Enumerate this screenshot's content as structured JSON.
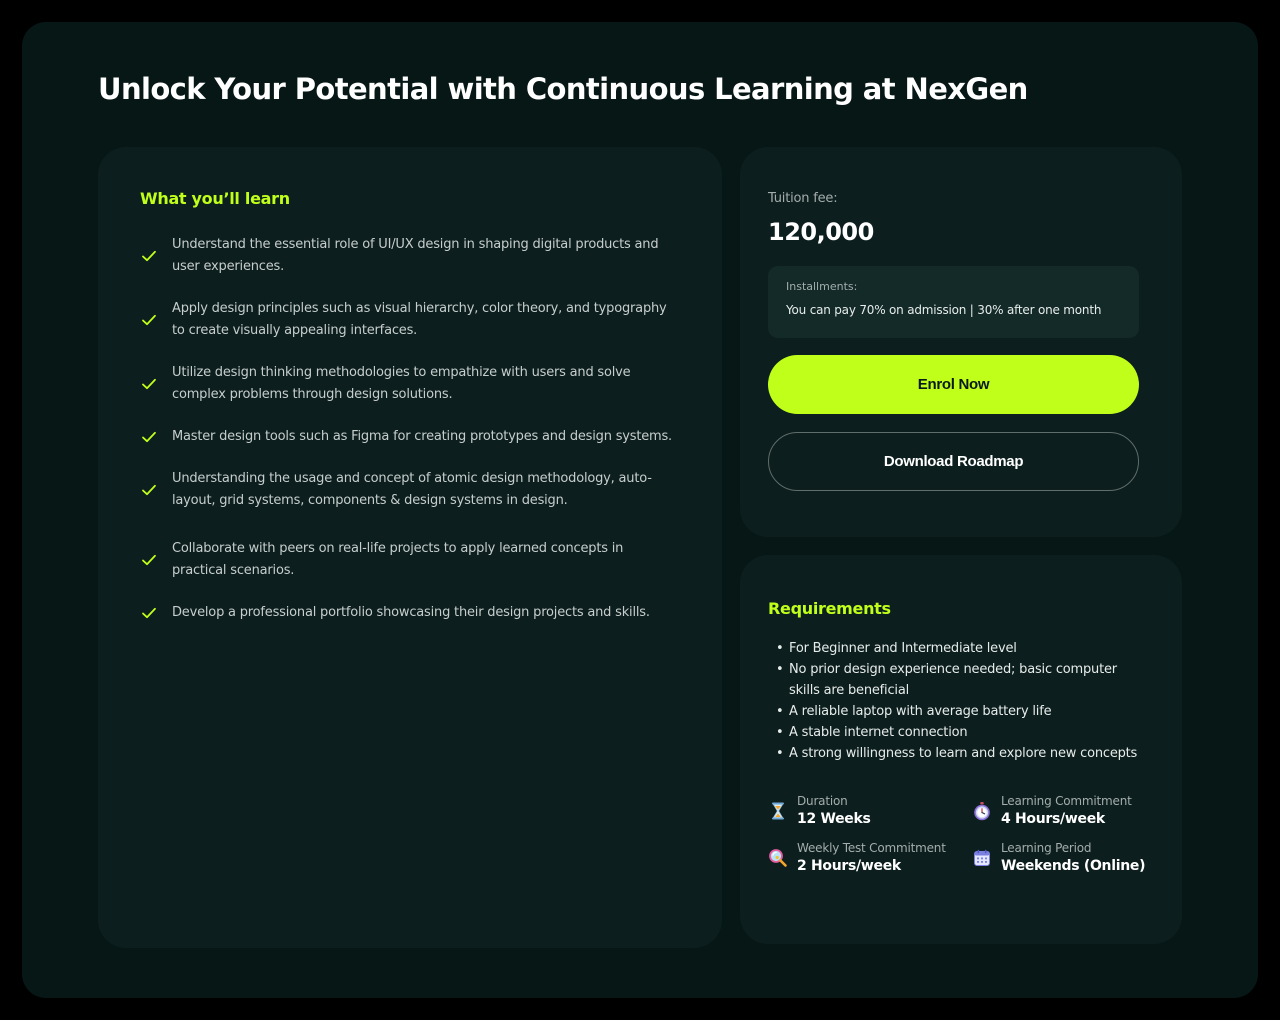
{
  "page": {
    "title": "Unlock Your Potential with Continuous Learning at NexGen"
  },
  "learn": {
    "heading": "What you’ll learn",
    "items": [
      "Understand the essential role of UI/UX design in shaping digital products and user experiences.",
      "Apply design principles such as visual hierarchy, color theory, and typography to create visually appealing interfaces.",
      "Utilize design thinking methodologies to empathize with users and solve complex problems through design solutions.",
      "Master design tools such as Figma for creating prototypes and design systems.",
      "Understanding the usage and concept of atomic design methodology, auto-layout, grid systems, components & design systems in design.",
      "Collaborate with peers on real-life projects to apply learned concepts in practical scenarios.",
      "Develop a professional portfolio showcasing their design projects and skills."
    ]
  },
  "fee": {
    "label": "Tuition fee:",
    "amount": "120,000",
    "installments_label": "Installments:",
    "installments_text": "You can pay 70% on admission | 30% after one month",
    "enrol_label": "Enrol Now",
    "roadmap_label": "Download Roadmap"
  },
  "requirements": {
    "heading": "Requirements",
    "bullet": "•",
    "items": [
      "For Beginner and Intermediate level",
      "No prior design experience needed; basic computer skills are beneficial",
      "A reliable laptop with average battery life",
      "A stable internet connection",
      "A strong willingness to learn and explore new concepts"
    ]
  },
  "stats": [
    {
      "icon": "hourglass-icon",
      "label": "Duration",
      "value": "12 Weeks"
    },
    {
      "icon": "stopwatch-icon",
      "label": "Learning Commitment",
      "value": "4 Hours/week"
    },
    {
      "icon": "magnifier-icon",
      "label": "Weekly Test Commitment",
      "value": "2 Hours/week"
    },
    {
      "icon": "calendar-icon",
      "label": "Learning Period",
      "value": "Weekends (Online)"
    }
  ],
  "colors": {
    "background": "#061716",
    "card": "#0c1e1d",
    "accent": "#c0ff1a",
    "muted_text": "#a3adac"
  }
}
